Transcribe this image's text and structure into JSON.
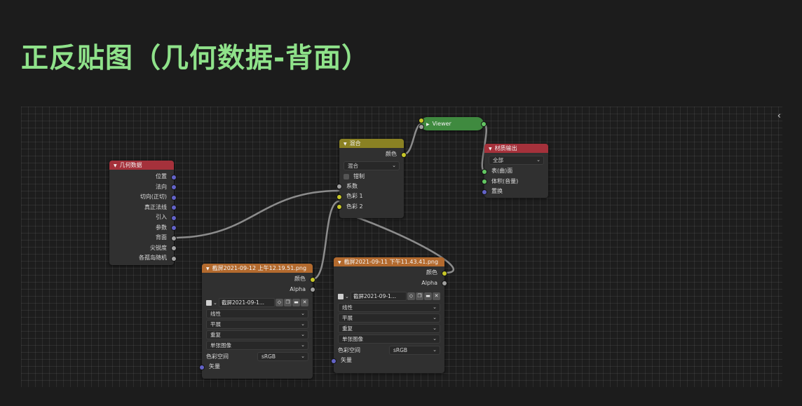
{
  "page": {
    "title": "正反贴图（几何数据-背面）"
  },
  "editor": {
    "panel_toggle_icon": "chevron-left-icon"
  },
  "nodes": {
    "geometry": {
      "title": "几何数据",
      "header_color": "#a5313b",
      "outputs": [
        "位置",
        "法向",
        "切向(正切)",
        "真正法线",
        "引入",
        "参数",
        "背面",
        "尖锐度",
        "各孤岛随机"
      ]
    },
    "mix": {
      "title": "混合",
      "header_color": "#8a8123",
      "output": "颜色",
      "blend_mode": "混合",
      "clamp_label": "钳制",
      "inputs": [
        "系数",
        "色彩 1",
        "色彩 2"
      ]
    },
    "viewer": {
      "title": "Viewer",
      "color": "#3f8a3f"
    },
    "material_output": {
      "title": "材质输出",
      "header_color": "#a5313b",
      "target": "全部",
      "inputs": [
        "表(曲)面",
        "体积(音量)",
        "置换"
      ]
    },
    "image1": {
      "title": "截屏2021-09-12 上午12.19.51.png",
      "header_color": "#b36a2e",
      "outputs": [
        "颜色",
        "Alpha"
      ],
      "image_name": "截屏2021-09-1...",
      "interpolation": "线性",
      "projection": "平展",
      "extension": "重复",
      "source": "单张图像",
      "colorspace_label": "色彩空间",
      "colorspace": "sRGB",
      "vector_label": "矢量"
    },
    "image2": {
      "title": "截屏2021-09-11 下午11.43.41.png",
      "header_color": "#b36a2e",
      "outputs": [
        "颜色",
        "Alpha"
      ],
      "image_name": "截屏2021-09-1...",
      "interpolation": "线性",
      "projection": "平展",
      "extension": "重复",
      "source": "单张图像",
      "colorspace_label": "色彩空间",
      "colorspace": "sRGB",
      "vector_label": "矢量"
    }
  },
  "icons": {
    "collapse": "▼",
    "dropdown": "⌄",
    "fake_user": "shield-icon",
    "duplicate": "duplicate-icon",
    "open": "folder-icon",
    "unlink": "✕"
  },
  "colors": {
    "title_green": "#8fe28a",
    "socket_vector": "#6363c7",
    "socket_color": "#c7c729",
    "socket_float": "#a1a1a1",
    "socket_shader": "#63c763",
    "link": "#8c8c8c"
  }
}
